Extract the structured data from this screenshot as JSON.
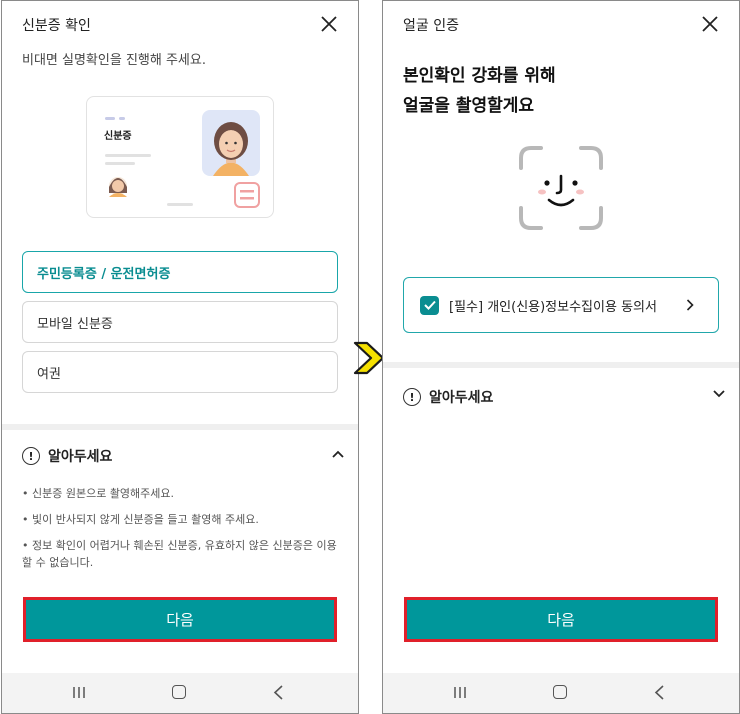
{
  "left": {
    "title": "신분증 확인",
    "subtitle": "비대면 실명확인을 진행해 주세요.",
    "card_label": "신분증",
    "options": [
      {
        "label": "주민등록증 / 운전면허증",
        "selected": true
      },
      {
        "label": "모바일 신분증",
        "selected": false
      },
      {
        "label": "여권",
        "selected": false
      }
    ],
    "notice_title": "알아두세요",
    "notice_state": "expanded",
    "bullets": [
      "• 신분증 원본으로 촬영해주세요.",
      "• 빛이 반사되지 않게 신분증을 들고 촬영해 주세요.",
      "• 정보 확인이 어렵거나 훼손된 신분증, 유효하지 않은 신분증은 이용할 수 없습니다."
    ],
    "next_button": "다음"
  },
  "right": {
    "title": "얼굴 인증",
    "headline_line1": "본인확인 강화를 위해",
    "headline_line2": "얼굴을 촬영할게요",
    "consent_label": "[필수] 개인(신용)정보수집이용 동의서",
    "consent_checked": true,
    "notice_title": "알아두세요",
    "notice_state": "collapsed",
    "next_button": "다음"
  },
  "colors": {
    "accent": "#00979b",
    "highlight_border": "#e0202a",
    "transition_arrow": "#f5e000"
  }
}
